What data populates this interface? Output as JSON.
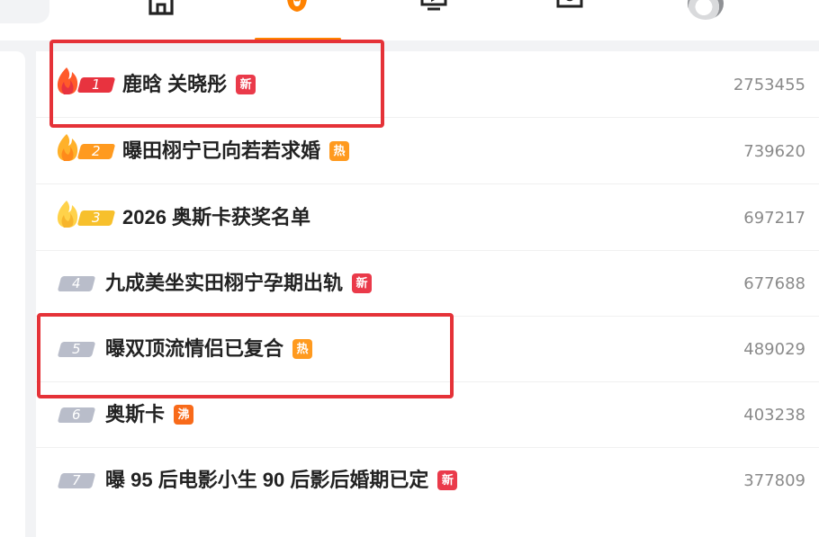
{
  "nav": {
    "icons": [
      "home-icon",
      "hot-icon",
      "video-icon",
      "message-icon"
    ],
    "active": "hot-icon",
    "accent": "#ff8200"
  },
  "hot_list": {
    "items": [
      {
        "rank": "1",
        "title": "鹿晗 关晓彤",
        "tag": "新",
        "tag_type": "new",
        "count": "2753455"
      },
      {
        "rank": "2",
        "title": "曝田栩宁已向若若求婚",
        "tag": "热",
        "tag_type": "hot",
        "count": "739620"
      },
      {
        "rank": "3",
        "title": "2026 奥斯卡获奖名单",
        "tag": "",
        "tag_type": "",
        "count": "697217"
      },
      {
        "rank": "4",
        "title": "九成美坐实田栩宁孕期出轨",
        "tag": "新",
        "tag_type": "new",
        "count": "677688"
      },
      {
        "rank": "5",
        "title": "曝双顶流情侣已复合",
        "tag": "热",
        "tag_type": "hot",
        "count": "489029"
      },
      {
        "rank": "6",
        "title": "奥斯卡",
        "tag": "沸",
        "tag_type": "boil",
        "count": "403238"
      },
      {
        "rank": "7",
        "title": "曝 95 后电影小生 90 后影后婚期已定",
        "tag": "新",
        "tag_type": "new",
        "count": "377809"
      }
    ]
  },
  "colors": {
    "highlight": "#e53238",
    "rank1": "#e8333f",
    "rank2": "#ff9a1f",
    "rank3": "#f7c02c",
    "rank_normal": "#b9bdca",
    "tag_new": "#ea3a4a",
    "tag_hot": "#ff9a1f",
    "tag_boil": "#f86a1a"
  }
}
